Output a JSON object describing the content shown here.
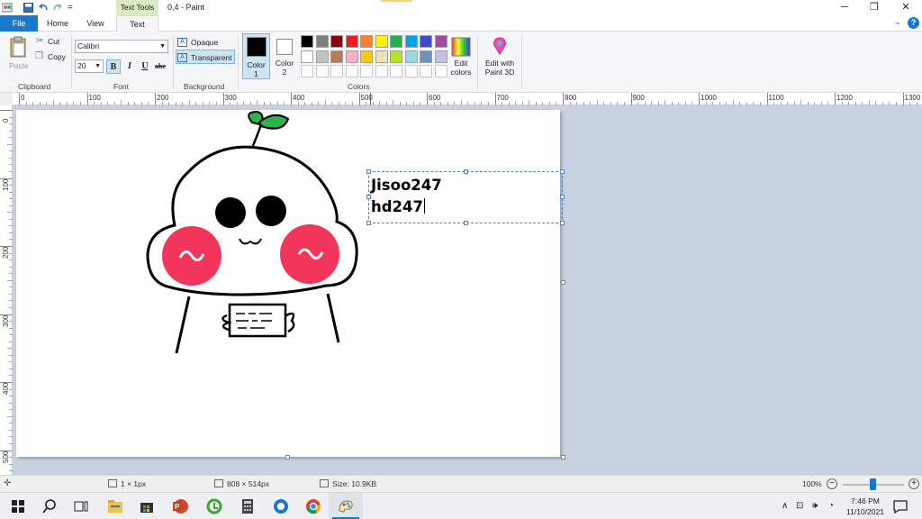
{
  "window": {
    "title": "0,4 - Paint",
    "context_tab": "Text Tools",
    "quick_access_more": "="
  },
  "tabs": [
    {
      "label": "File"
    },
    {
      "label": "Home"
    },
    {
      "label": "View"
    },
    {
      "label": "Text"
    }
  ],
  "clipboard": {
    "paste_label": "Paste",
    "cut_label": "Cut",
    "copy_label": "Copy",
    "group_label": "Clipboard"
  },
  "font": {
    "family": "Calibri",
    "size": "20",
    "bold": "B",
    "italic": "I",
    "underline": "U",
    "strike": "abc",
    "group_label": "Font"
  },
  "background": {
    "opaque_label": "Opaque",
    "transparent_label": "Transparent",
    "selected": "Transparent",
    "group_label": "Background"
  },
  "colors": {
    "color1_label": "Color 1",
    "color1_num": "1",
    "color1_text": "Color",
    "color2_text": "Color",
    "color2_num": "2",
    "color1": "#000000",
    "color2": "#ffffff",
    "edit_colors_line1": "Edit",
    "edit_colors_line2": "colors",
    "group_label": "Colors",
    "palette_row1": [
      "#000000",
      "#7f7f7f",
      "#880015",
      "#ed1c24",
      "#ff7f27",
      "#fff200",
      "#22b14c",
      "#00a2e8",
      "#3f48cc",
      "#a349a4"
    ],
    "palette_row2": [
      "#ffffff",
      "#c3c3c3",
      "#b97a57",
      "#ffaec9",
      "#ffc90e",
      "#efe4b0",
      "#b5e61d",
      "#99d9ea",
      "#7092be",
      "#c8bfe7"
    ]
  },
  "paint3d": {
    "line1": "Edit with",
    "line2": "Paint 3D"
  },
  "ruler": {
    "h_labels": [
      "0",
      "100",
      "200",
      "300",
      "400",
      "500",
      "600",
      "700",
      "800",
      "900",
      "1000",
      "1100",
      "1200",
      "1300"
    ],
    "v_labels": [
      "0",
      "100",
      "200",
      "300",
      "400",
      "500"
    ]
  },
  "textbox": {
    "line1": "Jisoo247",
    "line2": "hd247"
  },
  "status": {
    "cursor": "1 × 1px",
    "dimensions": "808 × 514px",
    "size": "Size: 10.9KB",
    "zoom": "100%",
    "zoom_minus": "−",
    "zoom_plus": "+",
    "zoom_level": 0.5
  },
  "taskbar": {
    "time": "7:46 PM",
    "date": "11/10/2021"
  }
}
